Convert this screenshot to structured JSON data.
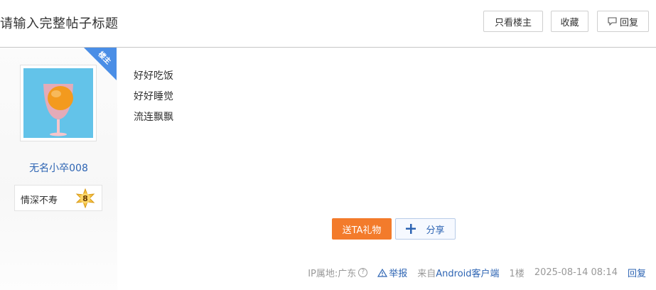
{
  "header": {
    "title": "请输入完整帖子标题",
    "only_op_label": "只看楼主",
    "favorite_label": "收藏",
    "reply_label": "回复"
  },
  "author": {
    "badge": "楼主",
    "username": "无名小卒008",
    "level_name": "情深不寿",
    "level": "8"
  },
  "post": {
    "lines": [
      "好好吃饭",
      "好好睡觉",
      "流连飘飘"
    ]
  },
  "actions": {
    "gift_label": "送TA礼物",
    "share_label": "分享"
  },
  "footer": {
    "ip_location": "IP属地:广东",
    "help_glyph": "?",
    "report_label": "举报",
    "from_prefix": "来自",
    "client": "Android客户端",
    "floor": "1楼",
    "datetime": "2025-08-14 08:14",
    "reply_label": "回复"
  },
  "colors": {
    "link": "#2d64b3",
    "gift_button": "#f37b2b",
    "badge": "#4a8ee6",
    "avatar_bg": "#63c3e9"
  },
  "icons": [
    "comment-icon",
    "help-icon",
    "warning-icon",
    "share-plus-icon",
    "level-star-icon"
  ]
}
